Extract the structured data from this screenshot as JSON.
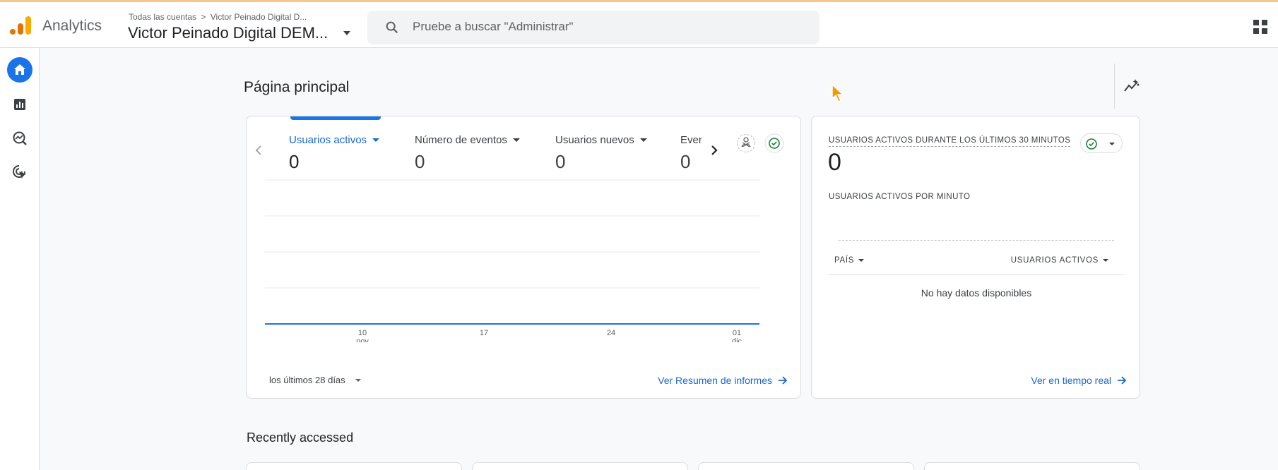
{
  "app": {
    "name": "Analytics"
  },
  "header": {
    "breadcrumb": [
      "Todas las cuentas",
      "Victor Peinado Digital D..."
    ],
    "account_title": "Victor Peinado Digital DEM...",
    "search_placeholder": "Pruebe a buscar \"Administrar\""
  },
  "sidebar": {
    "items": [
      {
        "name": "home",
        "icon": "home-icon",
        "active": true
      },
      {
        "name": "reports",
        "icon": "bar-chart-icon",
        "active": false
      },
      {
        "name": "explore",
        "icon": "explore-icon",
        "active": false
      },
      {
        "name": "advertising",
        "icon": "target-cursor-icon",
        "active": false
      }
    ]
  },
  "page": {
    "title": "Página principal"
  },
  "overview": {
    "metrics": [
      {
        "label": "Usuarios activos",
        "value": "0",
        "active": true
      },
      {
        "label": "Número de eventos",
        "value": "0",
        "active": false
      },
      {
        "label": "Usuarios nuevos",
        "value": "0",
        "active": false
      },
      {
        "label": "Ever",
        "value": "0",
        "active": false
      }
    ],
    "range_label": "los últimos 28 días",
    "link": "Ver Resumen de informes"
  },
  "chart_data": {
    "type": "line",
    "x": [
      "10 nov",
      "17",
      "24",
      "01 dic"
    ],
    "series": [
      {
        "values": [
          0,
          0,
          0,
          0
        ]
      }
    ],
    "x_ticks": [
      {
        "top": "10",
        "bottom": "nov"
      },
      {
        "top": "17",
        "bottom": ""
      },
      {
        "top": "24",
        "bottom": ""
      },
      {
        "top": "01",
        "bottom": "dic"
      }
    ],
    "grid": true,
    "color": "#1a73e8"
  },
  "realtime": {
    "title": "USUARIOS ACTIVOS DURANTE LOS ÚLTIMOS 30 MINUTOS",
    "value": "0",
    "per_minute_label": "USUARIOS ACTIVOS POR MINUTO",
    "col_country": "PAÍS",
    "col_users": "USUARIOS ACTIVOS",
    "empty": "No hay datos disponibles",
    "link": "Ver en tiempo real"
  },
  "recent": {
    "title": "Recently accessed"
  },
  "colors": {
    "accent": "#1a73e8",
    "link": "#1967d2",
    "brand_orange": "#e37400",
    "brand_yellow": "#f9ab00",
    "success": "#188038"
  }
}
